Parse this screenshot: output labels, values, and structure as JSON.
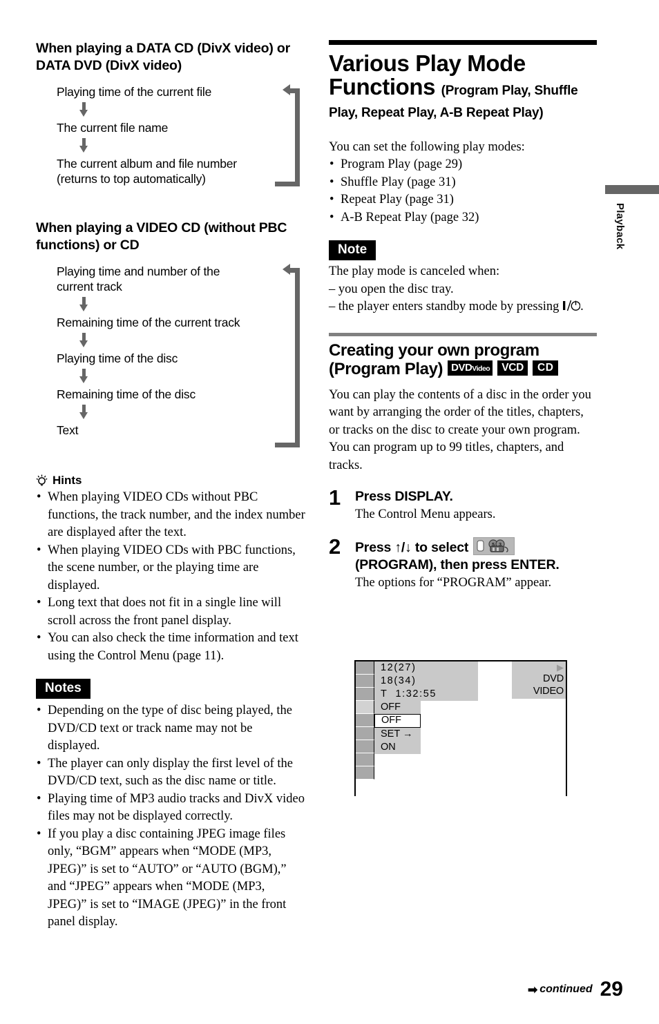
{
  "left_column": {
    "section1": {
      "heading": "When playing a DATA CD (DivX video) or DATA DVD (DivX video)",
      "flow_steps": [
        "Playing time of the current file",
        "The current file name",
        "The current album and file number (returns to top automatically)"
      ]
    },
    "section2": {
      "heading": "When playing a VIDEO CD (without PBC functions) or CD",
      "flow_steps": [
        "Playing time and number of the current track",
        "Remaining time of the current track",
        "Playing time of the disc",
        "Remaining time of the disc",
        "Text"
      ]
    },
    "hints": {
      "title": "Hints",
      "icon": "lightbulb-icon",
      "items": [
        "When playing VIDEO CDs without PBC functions, the track number, and the index number are displayed after the text.",
        "When playing VIDEO CDs with PBC functions, the scene number, or the playing time are displayed.",
        "Long text that does not fit in a single line will scroll across the front panel display.",
        "You can also check the time information and text using the Control Menu (page 11)."
      ]
    },
    "notes": {
      "title": "Notes",
      "items": [
        "Depending on the type of disc being played, the DVD/CD text or track name may not be displayed.",
        "The player can only display the first level of the DVD/CD text, such as the disc name or title.",
        "Playing time of MP3 audio tracks and DivX video files may not be displayed correctly.",
        " If you play a disc containing JPEG image files only, “BGM” appears when “MODE (MP3, JPEG)” is set to “AUTO” or “AUTO (BGM),” and “JPEG” appears when “MODE (MP3, JPEG)” is set to “IMAGE (JPEG)” in the front panel display."
      ]
    }
  },
  "right_column": {
    "title_main": "Various Play Mode Functions",
    "title_sub": "(Program Play, Shuffle Play, Repeat Play, A-B Repeat Play)",
    "intro": "You can set the following play modes:",
    "mode_list": [
      "Program Play (page 29)",
      "Shuffle Play (page 31)",
      "Repeat Play (page 31)",
      "A-B Repeat Play (page 32)"
    ],
    "note": {
      "title": "Note",
      "lead": "The play mode is canceled when:",
      "lines": [
        "– you open the disc tray.",
        "– the player enters standby mode by pressing"
      ],
      "power_symbol": "▏/⏻",
      "line2_tail": "."
    },
    "program_section": {
      "heading_line1": "Creating your own program",
      "heading_line2": "(Program Play)",
      "badges": [
        {
          "name": "dvd-video-badge",
          "main": "DVD",
          "small": "Video"
        },
        {
          "name": "vcd-badge",
          "main": "VCD"
        },
        {
          "name": "cd-badge",
          "main": "CD"
        }
      ],
      "paragraph": "You can play the contents of a disc in the order you want by arranging the order of the titles, chapters, or tracks on the disc to create your own program. You can program up to 99 titles, chapters, and tracks.",
      "steps": [
        {
          "num": "1",
          "title": "Press DISPLAY.",
          "desc": "The Control Menu appears."
        },
        {
          "num": "2",
          "title_part1": "Press ↑/↓ to select",
          "icon": "program-icon",
          "title_part2": "(PROGRAM), then press ENTER.",
          "desc": "The options for “PROGRAM” appear."
        }
      ]
    }
  },
  "osd_illustration": {
    "name": "control-menu-display",
    "rows": [
      {
        "text": "12(27)",
        "type": "num"
      },
      {
        "text": "18(34)",
        "type": "num"
      },
      {
        "text": "T  1:32:55",
        "type": "num"
      },
      {
        "text": "OFF",
        "type": "opt"
      },
      {
        "text": "OFF",
        "type": "sel"
      },
      {
        "text": "SET →",
        "type": "opt"
      },
      {
        "text": "ON",
        "type": "opt"
      }
    ],
    "icon_cells": 9,
    "highlighted_cell_index": 3,
    "disc_label": "DVD VIDEO",
    "play_symbol": "▶"
  },
  "side_tab": {
    "label": "Playback"
  },
  "footer": {
    "continued": "continued",
    "page_number": "29",
    "arrow": "➡"
  },
  "colors": {
    "gray_arrow": "#666666",
    "osd_gray": "#c9c9c9",
    "osd_icon_gray": "#a8a8a8",
    "rule_gray": "#808080"
  }
}
